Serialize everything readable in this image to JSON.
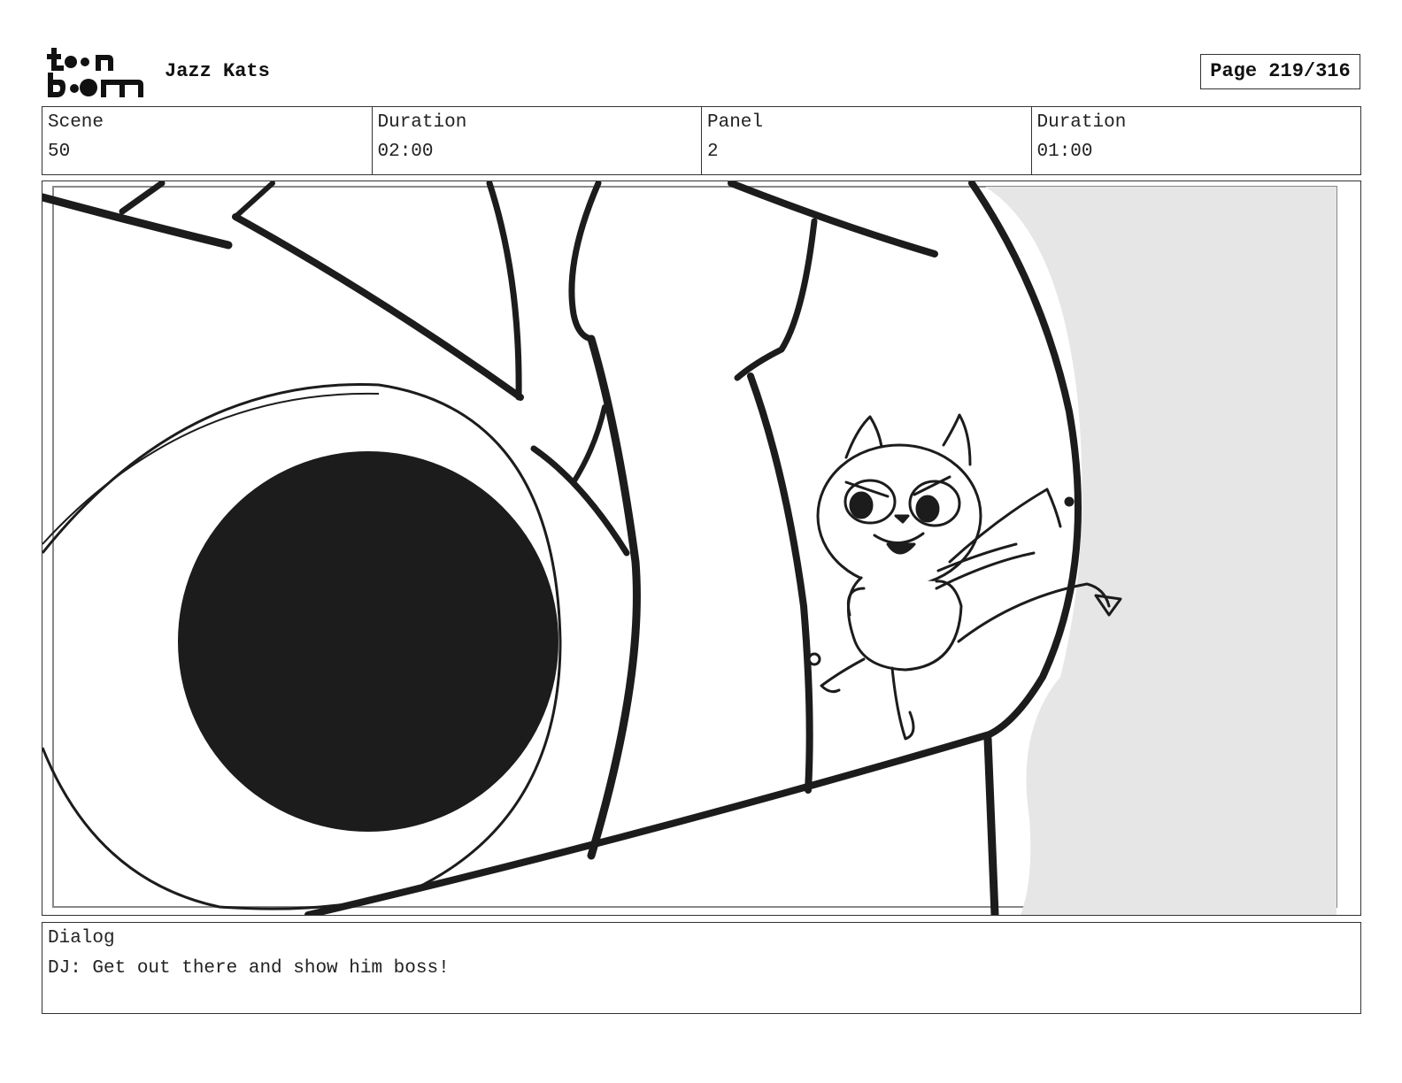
{
  "header": {
    "logo_line1": "to•n",
    "logo_line2": "b••m",
    "project_title": "Jazz Kats",
    "page_label": "Page 219/316"
  },
  "info": {
    "scene_label": "Scene",
    "scene_value": "50",
    "scene_duration_label": "Duration",
    "scene_duration_value": "02:00",
    "panel_label": "Panel",
    "panel_value": "2",
    "panel_duration_label": "Duration",
    "panel_duration_value": "01:00"
  },
  "dialog": {
    "label": "Dialog",
    "text": "DJ: Get out there and show him boss!"
  },
  "colors": {
    "ink": "#1c1c1c",
    "shade": "#e6e6e6",
    "border": "#333333"
  }
}
